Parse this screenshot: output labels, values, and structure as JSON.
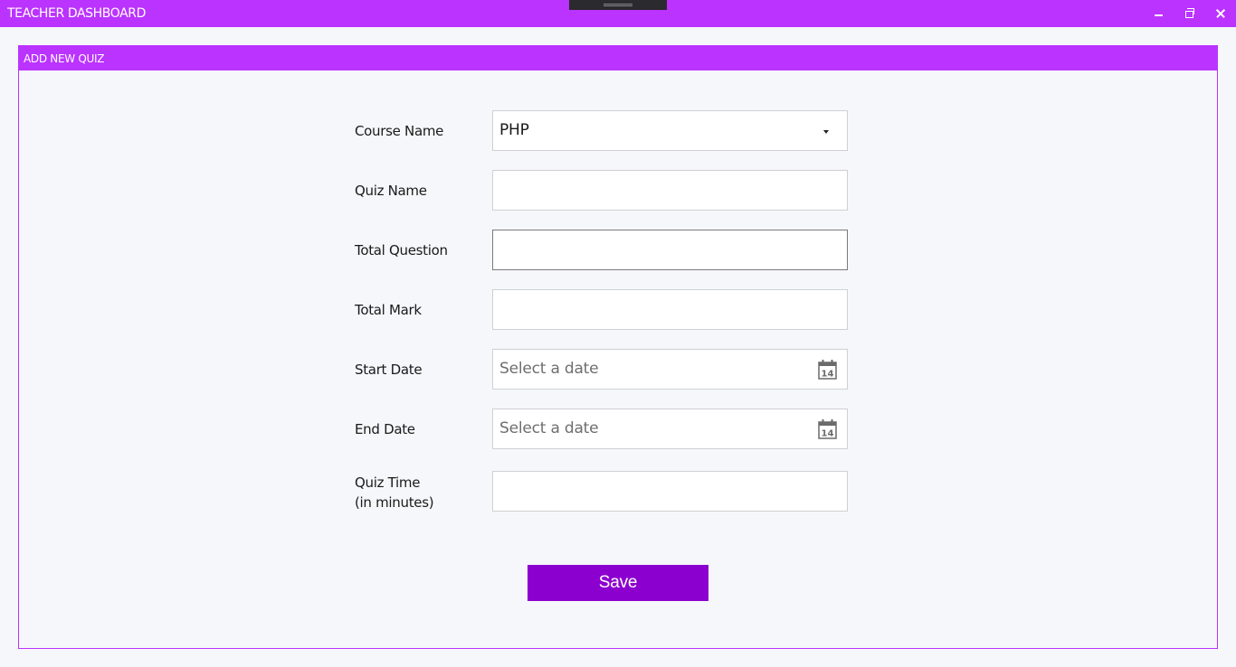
{
  "window": {
    "title": "TEACHER DASHBOARD"
  },
  "panel": {
    "title": "ADD NEW QUIZ"
  },
  "form": {
    "course_name": {
      "label": "Course Name",
      "value": "PHP"
    },
    "quiz_name": {
      "label": "Quiz Name",
      "value": ""
    },
    "total_question": {
      "label": "Total Question",
      "value": ""
    },
    "total_mark": {
      "label": "Total Mark",
      "value": ""
    },
    "start_date": {
      "label": "Start Date",
      "placeholder": "Select a date",
      "icon": "calendar-icon",
      "icon_day": "14"
    },
    "end_date": {
      "label": "End Date",
      "placeholder": "Select a date",
      "icon": "calendar-icon",
      "icon_day": "14"
    },
    "quiz_time": {
      "label_line1": "Quiz Time",
      "label_line2": "(in minutes)",
      "value": ""
    },
    "save_label": "Save"
  },
  "colors": {
    "accent": "#bb33ff",
    "button": "#8c00cf",
    "background": "#f6f7fa"
  }
}
